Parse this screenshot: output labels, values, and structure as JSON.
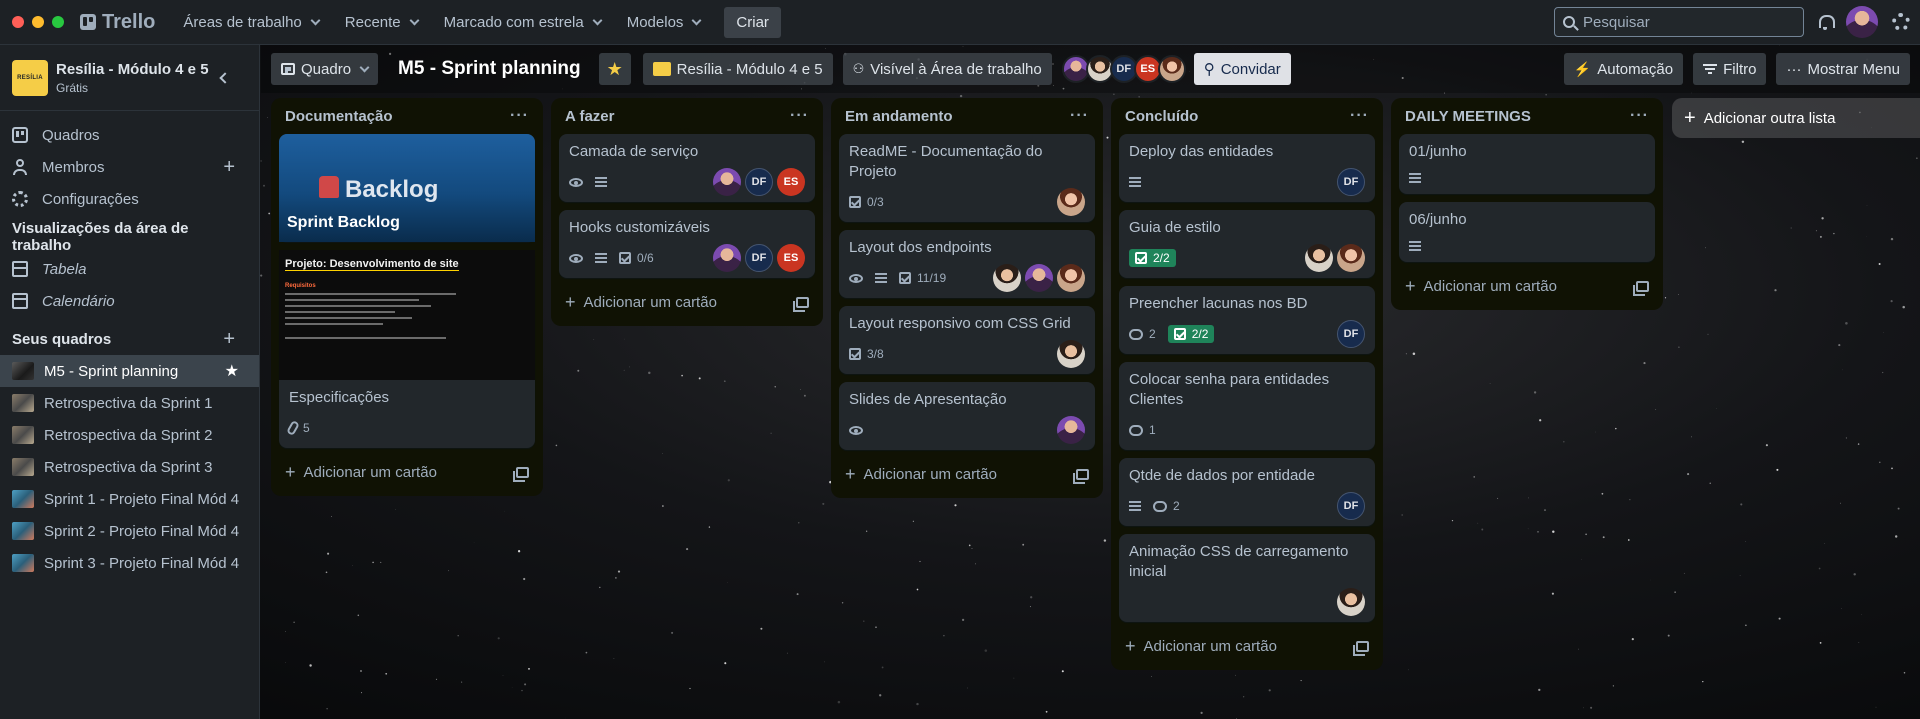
{
  "topbar": {
    "logo": "Trello",
    "nav": [
      "Áreas de trabalho",
      "Recente",
      "Marcado com estrela",
      "Modelos"
    ],
    "create": "Criar",
    "search_placeholder": "Pesquisar"
  },
  "sidebar": {
    "workspace_logo": "RESÍLIA",
    "workspace_name": "Resília - Módulo 4 e 5",
    "workspace_plan": "Grátis",
    "items": [
      "Quadros",
      "Membros",
      "Configurações"
    ],
    "views_title": "Visualizações da área de trabalho",
    "views": [
      "Tabela",
      "Calendário"
    ],
    "boards_title": "Seus quadros",
    "boards": [
      "M5 - Sprint planning",
      "Retrospectiva da Sprint 1",
      "Retrospectiva da Sprint 2",
      "Retrospectiva da Sprint 3",
      "Sprint 1 - Projeto Final Mód 4",
      "Sprint 2 - Projeto Final Mód 4",
      "Sprint 3 - Projeto Final Mód 4"
    ]
  },
  "board": {
    "view": "Quadro",
    "title": "M5 - Sprint planning",
    "workspace": "Resília - Módulo 4 e 5",
    "visibility": "Visível à Área de trabalho",
    "member_initials": [
      "DF",
      "ES"
    ],
    "invite": "Convidar",
    "automation": "Automação",
    "filter": "Filtro",
    "menu": "Mostrar Menu",
    "add_list": "Adicionar outra lista",
    "add_card": "Adicionar um cartão"
  },
  "lists": [
    {
      "title": "Documentação",
      "cards": [
        {
          "title": "Sprint Backlog",
          "cover_text": "Backlog"
        },
        {
          "title": "Especificações",
          "cover_title": "Projeto: Desenvolvimento de site",
          "cover_subtitle": "Requisitos",
          "attachments": "5"
        }
      ]
    },
    {
      "title": "A fazer",
      "cards": [
        {
          "title": "Camada de serviço",
          "avatars": [
            "photo1",
            "DF",
            "ES"
          ]
        },
        {
          "title": "Hooks customizáveis",
          "checklist": "0/6",
          "avatars": [
            "photo1",
            "DF",
            "ES"
          ]
        }
      ]
    },
    {
      "title": "Em andamento",
      "cards": [
        {
          "title": "ReadME - Documentação do Projeto",
          "checklist": "0/3"
        },
        {
          "title": "Layout dos endpoints",
          "checklist": "11/19"
        },
        {
          "title": "Layout responsivo com CSS Grid",
          "checklist": "3/8"
        },
        {
          "title": "Slides de Apresentação"
        }
      ]
    },
    {
      "title": "Concluído",
      "cards": [
        {
          "title": "Deploy das entidades"
        },
        {
          "title": "Guia de estilo",
          "checklist": "2/2"
        },
        {
          "title": "Preencher lacunas nos BD",
          "comments": "2",
          "checklist": "2/2"
        },
        {
          "title": "Colocar senha para entidades Clientes",
          "comments": "1"
        },
        {
          "title": "Qtde de dados por entidade",
          "comments": "2"
        },
        {
          "title": "Animação CSS de carregamento inicial"
        }
      ]
    },
    {
      "title": "DAILY MEETINGS",
      "cards": [
        {
          "title": "01/junho"
        },
        {
          "title": "06/junho"
        }
      ]
    }
  ],
  "colors": {
    "accent_yellow": "#f5cd47",
    "done_green": "#1f845a",
    "es_red": "#ca3521",
    "df_navy": "#172b4d"
  }
}
